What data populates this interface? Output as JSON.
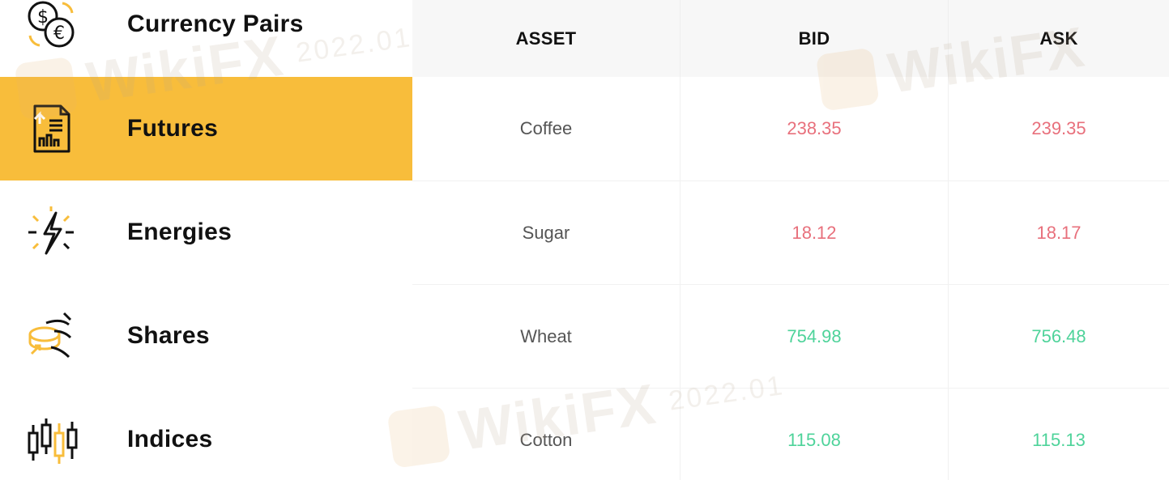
{
  "sidebar": {
    "accent_color": "#f8bd3b",
    "items": [
      {
        "label": "Currency Pairs",
        "icon": "currency-exchange-icon",
        "active": false
      },
      {
        "label": "Futures",
        "icon": "futures-document-icon",
        "active": true
      },
      {
        "label": "Energies",
        "icon": "lightning-icon",
        "active": false
      },
      {
        "label": "Shares",
        "icon": "shares-coins-icon",
        "active": false
      },
      {
        "label": "Indices",
        "icon": "candlestick-icon",
        "active": false
      }
    ]
  },
  "table": {
    "headers": {
      "asset": "ASSET",
      "bid": "BID",
      "ask": "ASK"
    },
    "rows": [
      {
        "asset": "Coffee",
        "bid": "238.35",
        "ask": "239.35",
        "trend": "down"
      },
      {
        "asset": "Sugar",
        "bid": "18.12",
        "ask": "18.17",
        "trend": "down"
      },
      {
        "asset": "Wheat",
        "bid": "754.98",
        "ask": "756.48",
        "trend": "up"
      },
      {
        "asset": "Cotton",
        "bid": "115.08",
        "ask": "115.13",
        "trend": "up"
      }
    ],
    "colors": {
      "down": "#e8707c",
      "up": "#4ed39a"
    }
  },
  "watermark": {
    "brand": "WikiFX",
    "year": "2022.01"
  }
}
